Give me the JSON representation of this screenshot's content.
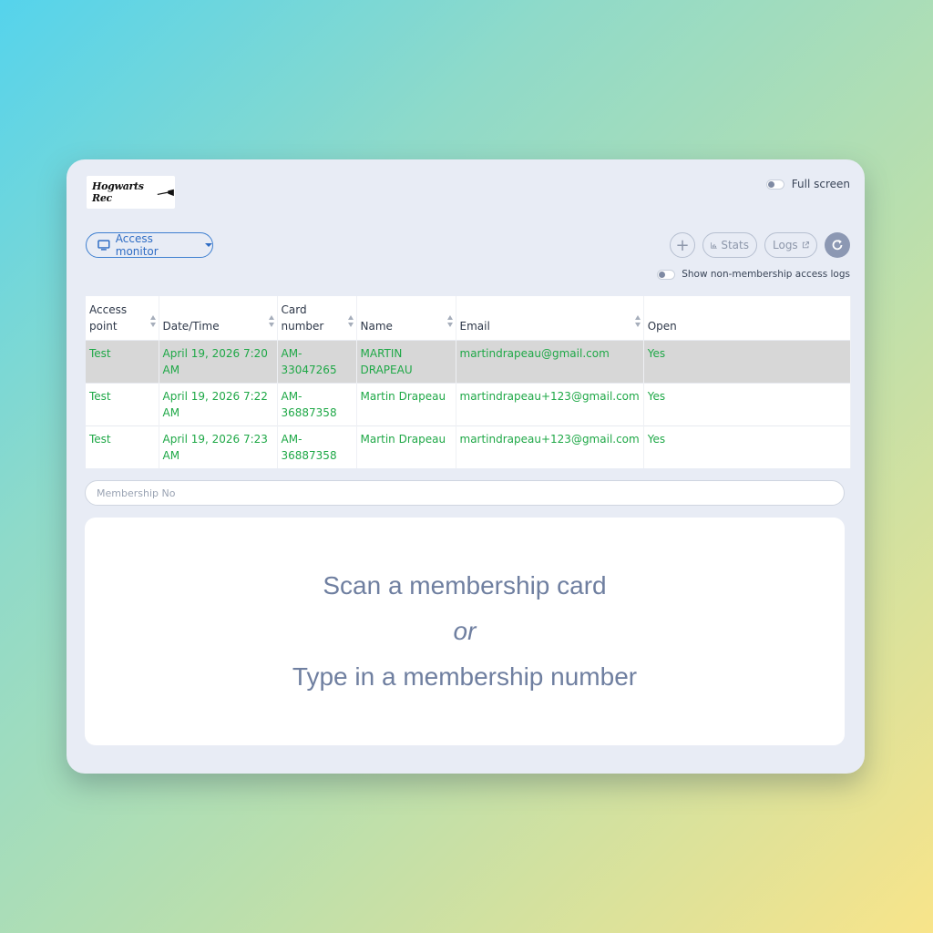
{
  "logo": {
    "text": "Hogwarts Rec"
  },
  "fullscreen": {
    "label": "Full screen"
  },
  "access_monitor": {
    "label": "Access monitor"
  },
  "toolbar": {
    "add": "+",
    "stats": "Stats",
    "logs": "Logs"
  },
  "non_membership": {
    "label": "Show non-membership access logs"
  },
  "table": {
    "columns": [
      "Access point",
      "Date/Time",
      "Card number",
      "Name",
      "Email",
      "Open"
    ],
    "rows": [
      {
        "access_point": "Test",
        "datetime": "April 19, 2026 7:20 AM",
        "card": "AM-33047265",
        "name": "MARTIN DRAPEAU",
        "email": "martindrapeau@gmail.com",
        "open": "Yes"
      },
      {
        "access_point": "Test",
        "datetime": "April 19, 2026 7:22 AM",
        "card": "AM-36887358",
        "name": "Martin Drapeau",
        "email": "martindrapeau+123@gmail.com",
        "open": "Yes"
      },
      {
        "access_point": "Test",
        "datetime": "April 19, 2026 7:23 AM",
        "card": "AM-36887358",
        "name": "Martin Drapeau",
        "email": "martindrapeau+123@gmail.com",
        "open": "Yes"
      }
    ]
  },
  "membership_input": {
    "placeholder": "Membership No",
    "value": ""
  },
  "scan": {
    "line1": "Scan a membership card",
    "line2": "or",
    "line3": "Type in a membership number"
  },
  "colors": {
    "accent": "#2e6cc4",
    "row_text": "#1fa847",
    "selected_row": "#d7d7d7",
    "scan_text": "#6f7fa0"
  },
  "icons": [
    "monitor-icon",
    "chart-icon",
    "external-link-icon",
    "refresh-icon",
    "broom-icon"
  ]
}
